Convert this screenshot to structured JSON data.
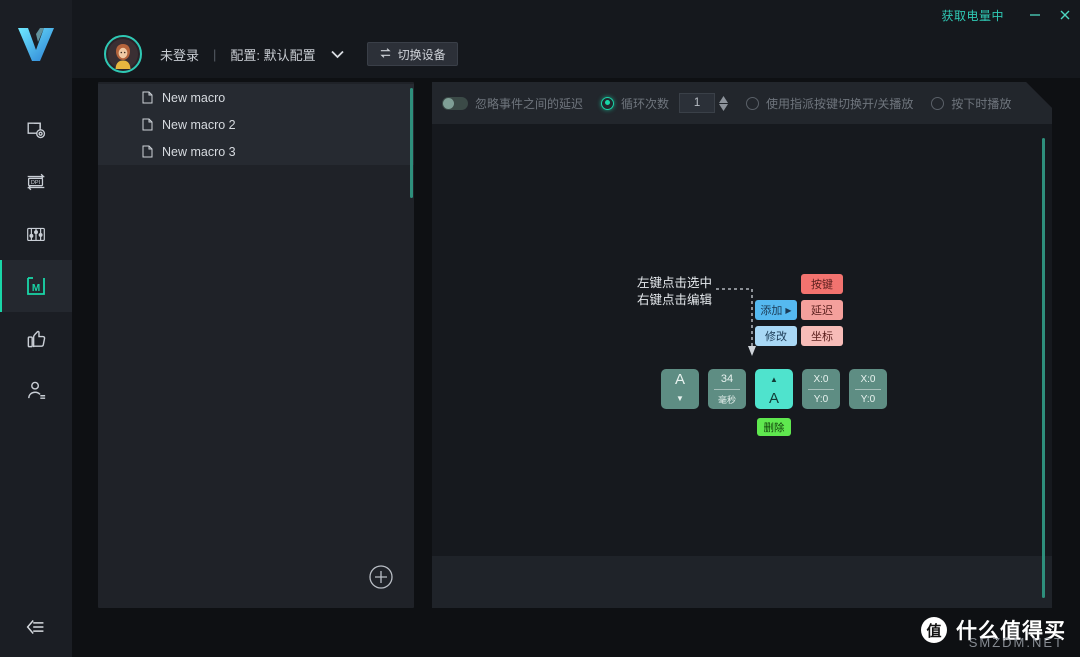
{
  "titlebar": {
    "battery_status": "获取电量中",
    "minimize_label": "—",
    "close_label": "✕"
  },
  "header": {
    "login_status": "未登录",
    "separator": "|",
    "profile_label": "配置: 默认配置",
    "switch_device_label": "切换设备",
    "switch_device_icon": "swap-icon",
    "avatar_icon": "user-avatar",
    "chevron_icon": "chevron-down-icon"
  },
  "rail": {
    "logo_icon": "v-logo",
    "items": [
      {
        "icon": "mouse-settings-icon",
        "name": "sidebar-item-mouse",
        "active": false
      },
      {
        "icon": "dpi-icon",
        "name": "sidebar-item-dpi",
        "active": false
      },
      {
        "icon": "sliders-icon",
        "name": "sidebar-item-sliders",
        "active": false
      },
      {
        "icon": "macro-m-icon",
        "name": "sidebar-item-macro",
        "active": true
      },
      {
        "icon": "thumbs-up-icon",
        "name": "sidebar-item-thumbsup",
        "active": false
      },
      {
        "icon": "user-profile-icon",
        "name": "sidebar-item-profile",
        "active": false
      }
    ],
    "collapse_icon": "collapse-left-icon"
  },
  "macro_list": {
    "items": [
      {
        "label": "New macro"
      },
      {
        "label": "New macro 2"
      },
      {
        "label": "New macro 3"
      }
    ],
    "add_icon": "plus-circle-icon",
    "doc_icon": "document-icon"
  },
  "toolbar": {
    "ignore_delay_label": "忽略事件之间的延迟",
    "ignore_delay_on": false,
    "loop_count_label": "循环次数",
    "loop_count_selected": true,
    "loop_count_value": "1",
    "toggle_play_label": "使用指派按键切换开/关播放",
    "toggle_play_selected": false,
    "press_play_label": "按下时播放",
    "press_play_selected": false,
    "spinner_icon": "spinner-up-down-icon"
  },
  "diagram": {
    "tip_line1": "左键点击选中",
    "tip_line2": "右键点击编辑",
    "context_buttons": [
      {
        "label": "添加",
        "style": "blue",
        "name": "context-add-button",
        "has_arrow": true
      },
      {
        "label": "修改",
        "style": "blue2",
        "name": "context-modify-button",
        "has_arrow": false
      },
      {
        "label": "按键",
        "style": "red",
        "name": "context-key-button",
        "has_arrow": false
      },
      {
        "label": "延迟",
        "style": "red2",
        "name": "context-delay-button",
        "has_arrow": false
      },
      {
        "label": "坐标",
        "style": "red3",
        "name": "context-coord-button",
        "has_arrow": false
      }
    ],
    "event_cards": [
      {
        "name": "event-card-key-a-up",
        "top": "A",
        "bot": "▼",
        "selected": false,
        "divider": false,
        "big_top": true
      },
      {
        "name": "event-card-delay",
        "top": "34",
        "bot": "毫秒",
        "selected": false,
        "divider": true,
        "big_top": false
      },
      {
        "name": "event-card-key-a-down",
        "top": "▲",
        "bot": "A",
        "selected": true,
        "divider": false,
        "big_top": false
      },
      {
        "name": "event-card-coord-1",
        "top": "X:0",
        "bot": "Y:0",
        "selected": false,
        "divider": true,
        "big_top": false
      },
      {
        "name": "event-card-coord-2",
        "top": "X:0",
        "bot": "Y:0",
        "selected": false,
        "divider": true,
        "big_top": false
      }
    ],
    "delete_label": "删除"
  },
  "watermark": {
    "badge": "值",
    "text": "什么值得买",
    "sub": "SMZDM.NET"
  },
  "colors": {
    "accent_teal": "#19d6a8",
    "battery_teal": "#2fc8b4",
    "selected_card": "#4fe3cd",
    "delete_green": "#5fe84f"
  }
}
